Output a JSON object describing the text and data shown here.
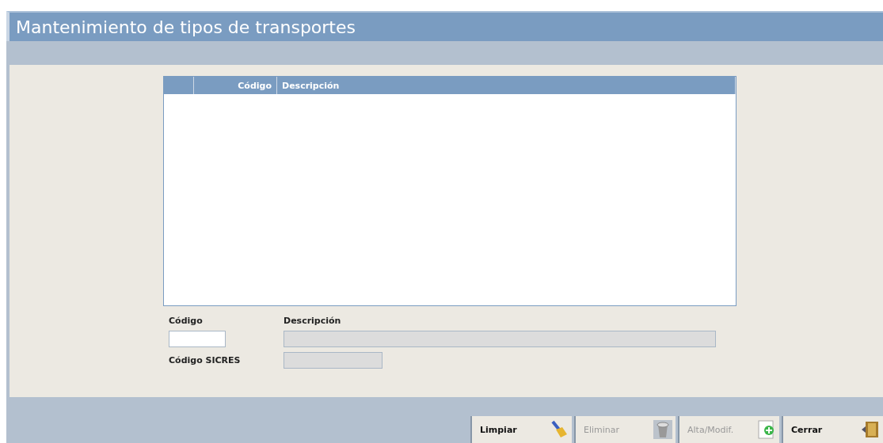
{
  "window": {
    "title": "Mantenimiento de tipos de transportes"
  },
  "table": {
    "columns": [
      "Código",
      "Descripción"
    ]
  },
  "fields": [
    {
      "label": "Código",
      "disabled": false,
      "kind": "short"
    },
    {
      "label": "Descripción",
      "disabled": true,
      "kind": "wide"
    },
    {
      "label": "Código SICRES",
      "disabled": true,
      "kind": "medium"
    }
  ],
  "buttons": [
    {
      "label": "Limpiar",
      "disabled": false,
      "kind": "brush"
    },
    {
      "label": "Eliminar",
      "disabled": true,
      "kind": "trash"
    },
    {
      "label": "Alta/Modif.",
      "disabled": true,
      "kind": "add"
    },
    {
      "label": "Cerrar",
      "disabled": false,
      "kind": "exit"
    }
  ]
}
